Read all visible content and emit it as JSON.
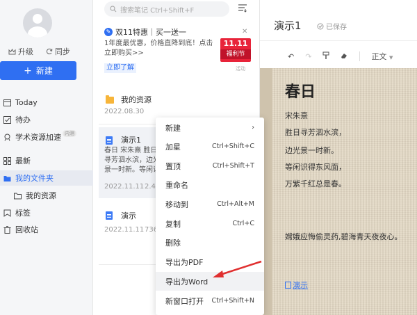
{
  "sidebar": {
    "upgrade": "升级",
    "sync": "同步",
    "new_button": "新建",
    "items": [
      {
        "label": "Today"
      },
      {
        "label": "待办"
      },
      {
        "label": "学术资源加速",
        "badge": "内测"
      },
      {
        "label": "最新"
      },
      {
        "label": "我的文件夹"
      },
      {
        "label": "我的资源"
      },
      {
        "label": "标签"
      },
      {
        "label": "回收站"
      }
    ]
  },
  "list": {
    "search_placeholder": "搜索笔记 Ctrl+Shift+F",
    "promo": {
      "title": "双11特惠｜买一送一",
      "desc": "1年度最优惠，价格直降到底！点击立即购买>>",
      "tag_big": "11.11",
      "tag_small": "福利节",
      "link": "立即了解",
      "ad_label": "活动"
    },
    "items": [
      {
        "title": "我的资源",
        "date": "2022.08.30"
      },
      {
        "title": "演示1",
        "snippet": "春日 宋朱熹 胜日寻芳泗水滨，边光景一时新。等闲识得东风面，万紫千红总是春。嫦娥应悔偷灵药,碧海青天夜夜心。",
        "date": "2022.11.11",
        "size": "2.4"
      },
      {
        "title": "演示",
        "date": "2022.11.11",
        "size": "736"
      }
    ]
  },
  "context_menu": [
    {
      "label": "新建",
      "shortcut": "›"
    },
    {
      "label": "加星",
      "shortcut": "Ctrl+Shift+C"
    },
    {
      "label": "置顶",
      "shortcut": "Ctrl+Shift+T"
    },
    {
      "label": "重命名",
      "shortcut": ""
    },
    {
      "label": "移动到",
      "shortcut": "Ctrl+Alt+M"
    },
    {
      "label": "复制",
      "shortcut": "Ctrl+C"
    },
    {
      "label": "删除",
      "shortcut": ""
    },
    {
      "label": "导出为PDF",
      "shortcut": ""
    },
    {
      "label": "导出为Word",
      "shortcut": ""
    },
    {
      "label": "新窗口打开",
      "shortcut": "Ctrl+Shift+N"
    }
  ],
  "editor": {
    "title": "演示1",
    "saved": "已保存",
    "style_select": "正文",
    "poem_title": "春日",
    "lines": [
      "宋朱熹",
      "胜日寻芳泗水滨，",
      "边光景一时新。",
      "等闲识得东风面，",
      "万紫千红总是春。"
    ],
    "extra_line": "嫦娥应悔偷灵药,碧海青天夜夜心。",
    "link_text": "演示"
  },
  "colors": {
    "accent": "#2f6ff2",
    "promo_red": "#e8243a",
    "folder": "#f7b53a",
    "arrow": "#e03030"
  }
}
